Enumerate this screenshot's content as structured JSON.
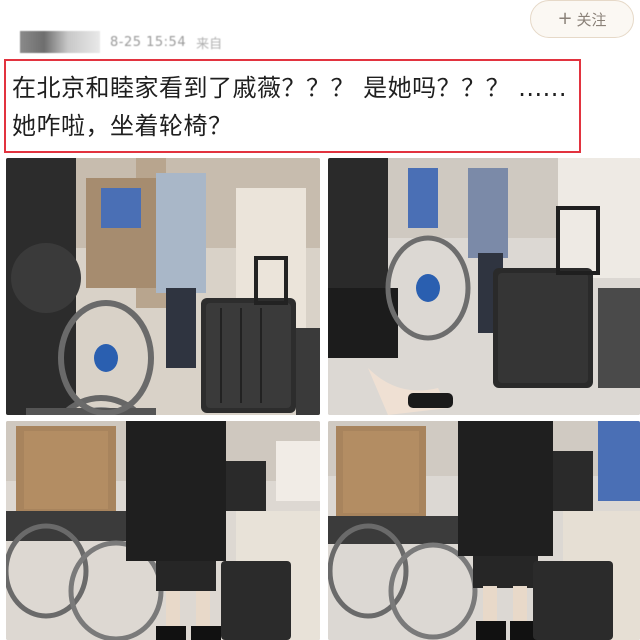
{
  "post": {
    "meta_time": "8-25 15:54",
    "meta_source": "来自",
    "follow_label": "关注",
    "follow_icon": "plus-icon",
    "text": "在北京和睦家看到了戚薇？？？ 是她吗？？？ ......她咋啦，坐着轮椅？"
  },
  "photos": {
    "count": 4,
    "subjects": [
      "wheelchair",
      "suitcase"
    ]
  },
  "colors": {
    "highlight_border": "#e2333f",
    "follow_border": "#e6d9c8",
    "meta_text": "#9a9a9a"
  }
}
